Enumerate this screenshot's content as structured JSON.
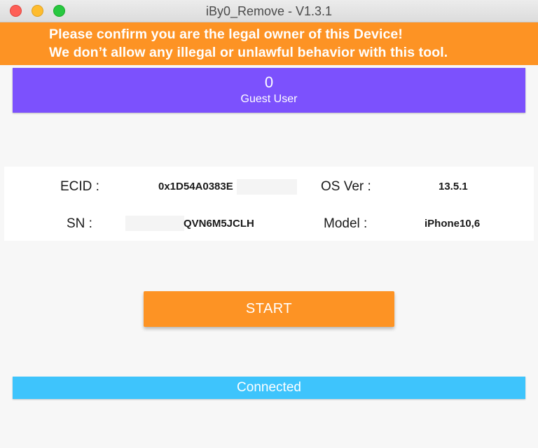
{
  "window": {
    "title": "iBy0_Remove - V1.3.1",
    "controls": [
      "close-icon",
      "minimize-icon",
      "zoom-icon"
    ]
  },
  "banner": {
    "line1": "Please confirm you are the legal owner of this Device!",
    "line2": "We don’t allow any illegal or unlawful behavior with this tool.",
    "color": "#fd9324"
  },
  "user": {
    "count": "0",
    "label": "Guest User",
    "color": "#7c51fd"
  },
  "device": {
    "ecid_label": "ECID :",
    "ecid_value": "0x1D54A0383E",
    "os_label": "OS Ver :",
    "os_value": "13.5.1",
    "sn_label": "SN :",
    "sn_value": "QVN6M5JCLH",
    "model_label": "Model :",
    "model_value": "iPhone10,6"
  },
  "actions": {
    "start_label": "START"
  },
  "status": {
    "text": "Connected",
    "color": "#3ec4fc"
  }
}
